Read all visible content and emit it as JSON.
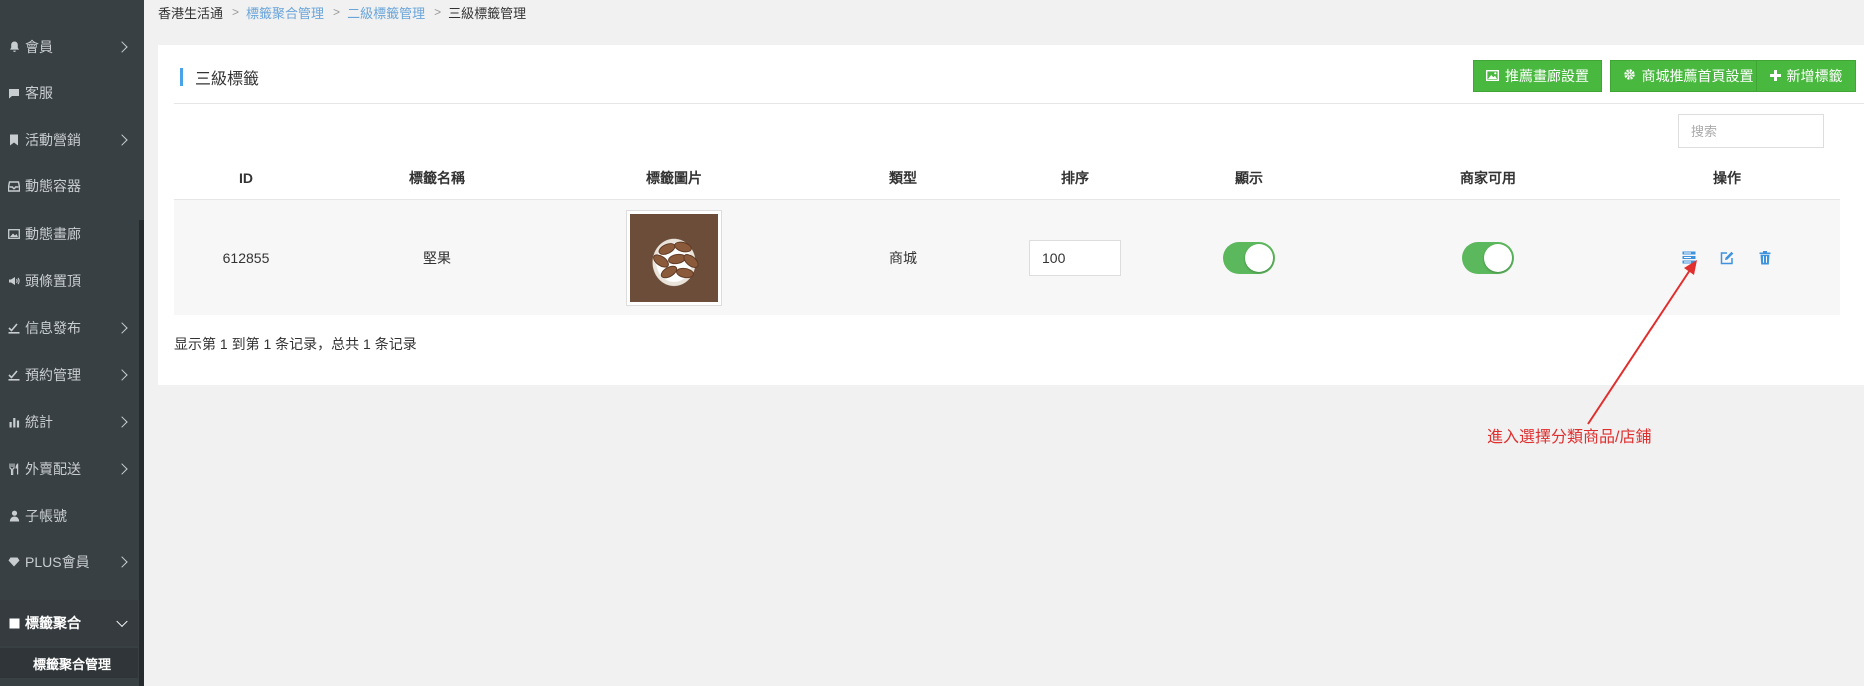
{
  "sidebar": {
    "items": [
      {
        "label": "會員",
        "icon": "bell-icon",
        "has_arrow": true
      },
      {
        "label": "客服",
        "icon": "chat-icon",
        "has_arrow": false
      },
      {
        "label": "活動營銷",
        "icon": "bookmark-icon",
        "has_arrow": true
      },
      {
        "label": "動態容器",
        "icon": "inbox-icon",
        "has_arrow": false
      },
      {
        "label": "動態畫廊",
        "icon": "image-icon",
        "has_arrow": false
      },
      {
        "label": "頭條置頂",
        "icon": "megaphone-icon",
        "has_arrow": false
      },
      {
        "label": "信息發布",
        "icon": "check-pen-icon",
        "has_arrow": true
      },
      {
        "label": "預約管理",
        "icon": "check-pen-icon",
        "has_arrow": true
      },
      {
        "label": "統計",
        "icon": "bar-chart-icon",
        "has_arrow": true
      },
      {
        "label": "外賣配送",
        "icon": "cutlery-icon",
        "has_arrow": true
      },
      {
        "label": "子帳號",
        "icon": "user-icon",
        "has_arrow": false
      },
      {
        "label": "PLUS會員",
        "icon": "diamond-icon",
        "has_arrow": true
      },
      {
        "label": "標籤聚合",
        "icon": "square-icon",
        "has_arrow": true,
        "active": true
      }
    ],
    "sub_item": "標籤聚合管理"
  },
  "breadcrumb": [
    "香港生活通",
    "標籤聚合管理",
    "二級標籤管理",
    "三級標籤管理"
  ],
  "panel": {
    "title": "三級標籤",
    "buttons": {
      "gallery": "推薦畫廊設置",
      "mall_home": "商城推薦首頁設置",
      "add": "新增標籤"
    },
    "search_placeholder": "搜索"
  },
  "table": {
    "headers": [
      "ID",
      "標籤名稱",
      "標籤圖片",
      "類型",
      "排序",
      "顯示",
      "商家可用",
      "操作"
    ],
    "rows": [
      {
        "id": "612855",
        "name": "堅果",
        "image": "almonds-in-bowl",
        "type": "商城",
        "sort": "100",
        "display": true,
        "merchant_available": true
      }
    ]
  },
  "footer_text": "显示第 1 到第 1 条记录，总共 1 条记录",
  "annotation": "進入選擇分類商品/店鋪",
  "colors": {
    "sidebar_bg": "#394044",
    "accent_green": "#49b83f",
    "toggle_green": "#5cb85c",
    "link_blue": "#6aa5d9",
    "annotation_red": "#e02f2f"
  }
}
